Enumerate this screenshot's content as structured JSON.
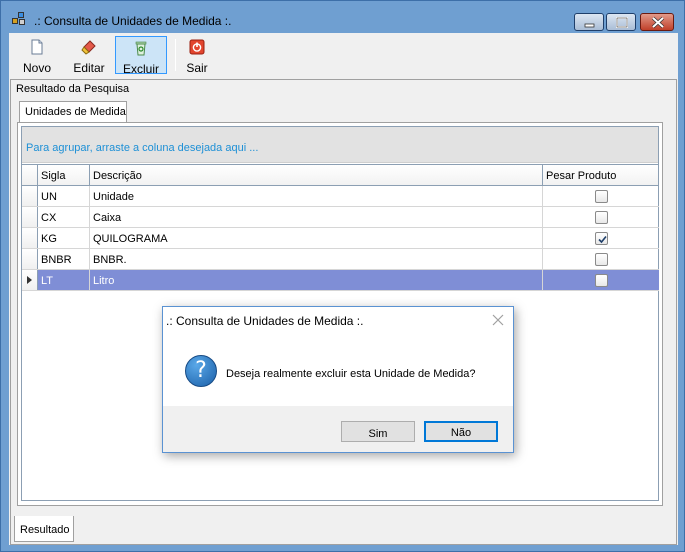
{
  "window": {
    "title": ".: Consulta de Unidades de Medida :."
  },
  "toolbar": {
    "novo_label": "Novo",
    "editar_label": "Editar",
    "excluir_label": "Excluir",
    "sair_label": "Sair"
  },
  "panel": {
    "group_title": "Resultado da Pesquisa",
    "tab_label": "Unidades de Medida",
    "group_hint": "Para agrupar, arraste a coluna desejada aqui ...",
    "bottom_tab_label": "Resultado"
  },
  "grid": {
    "columns": [
      "Sigla",
      "Descrição",
      "Pesar Produto"
    ],
    "rows": [
      {
        "sigla": "UN",
        "descricao": "Unidade",
        "pesar": false
      },
      {
        "sigla": "CX",
        "descricao": "Caixa",
        "pesar": false
      },
      {
        "sigla": "KG",
        "descricao": "QUILOGRAMA",
        "pesar": true
      },
      {
        "sigla": "BNBR",
        "descricao": "BNBR.",
        "pesar": false
      },
      {
        "sigla": "LT",
        "descricao": "Litro",
        "pesar": false
      }
    ],
    "selected_row": 4
  },
  "dialog": {
    "title": ".: Consulta de Unidades de Medida :.",
    "message": "Deseja realmente excluir esta Unidade de Medida?",
    "icon": "question-icon",
    "yes_label": "Sim",
    "no_label": "Não"
  },
  "colors": {
    "window_frame": "#6f9fd1",
    "selected_row": "#7f8ed6",
    "hint_text": "#1e90d6",
    "default_button_border": "#0078d7"
  }
}
